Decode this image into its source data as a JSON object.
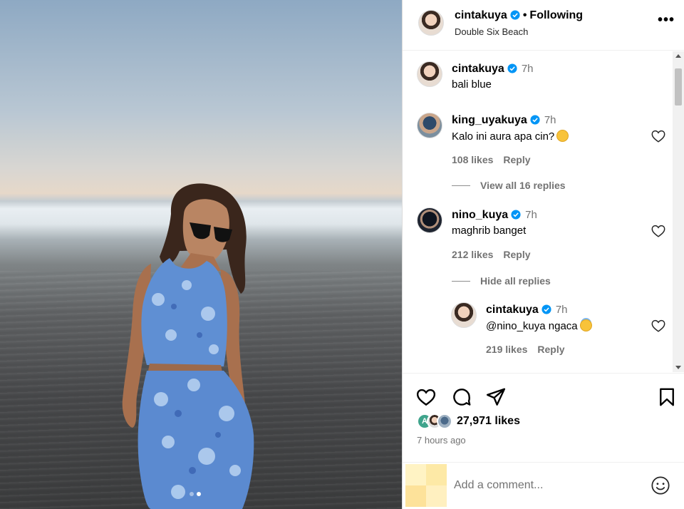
{
  "post": {
    "username": "cintakuya",
    "following_label": "Following",
    "location": "Double Six Beach",
    "caption": "bali blue",
    "caption_time": "7h",
    "likes": "27,971 likes",
    "time_ago": "7 hours ago"
  },
  "comments": [
    {
      "username": "king_uyakuya",
      "time": "7h",
      "text": "Kalo ini aura apa cin?",
      "emoji": "laughing-emoji",
      "likes": "108 likes",
      "reply": "Reply"
    },
    {
      "username": "nino_kuya",
      "time": "7h",
      "text": "maghrib banget",
      "likes": "212 likes",
      "reply": "Reply"
    }
  ],
  "thread": {
    "view_replies": "View all 16 replies",
    "hide_replies": "Hide all replies"
  },
  "reply": {
    "username": "cintakuya",
    "time": "7h",
    "text": "@nino_kuya ngaca",
    "emoji": "halo-face-emoji",
    "likes": "219 likes",
    "reply": "Reply"
  },
  "add_comment": {
    "placeholder": "Add a comment..."
  },
  "icons": [
    "verified-icon",
    "more-icon",
    "heart-icon",
    "comment-icon",
    "share-icon",
    "bookmark-icon",
    "smile-icon"
  ],
  "colors": {
    "verified": "#0095f6",
    "muted": "#737373",
    "border": "#dbdbdb"
  },
  "carousel": {
    "slides": 2,
    "active": 2
  }
}
